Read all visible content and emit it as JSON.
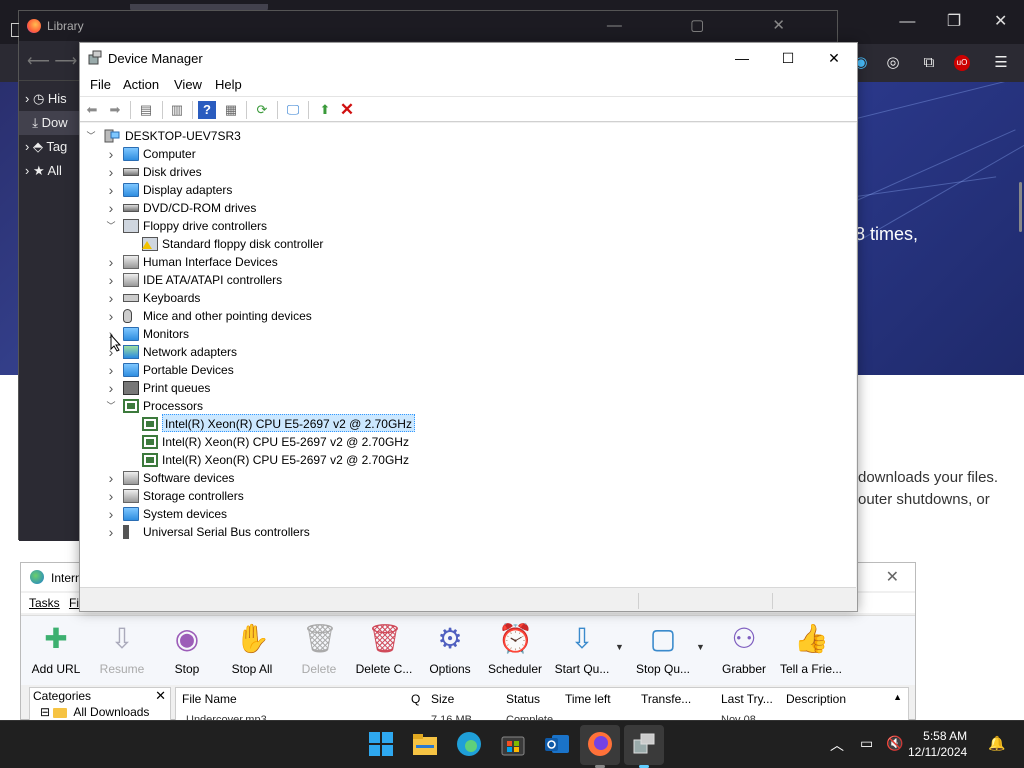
{
  "browser": {
    "hero_text": "o 8 times,",
    "body_text_1": "downloads your files.",
    "body_text_2": "outer shutdowns, or"
  },
  "library": {
    "title": "Library",
    "sidebar": [
      {
        "label": "His",
        "icon": "clock-icon"
      },
      {
        "label": "Dow",
        "icon": "download-icon"
      },
      {
        "label": "Tag",
        "icon": "tag-icon"
      },
      {
        "label": "All",
        "icon": "star-icon"
      }
    ]
  },
  "device_manager": {
    "title": "Device Manager",
    "menu": [
      "File",
      "Action",
      "View",
      "Help"
    ],
    "root": "DESKTOP-UEV7SR3",
    "tree": [
      {
        "label": "Computer",
        "state": "collapsed",
        "icon": "monitor"
      },
      {
        "label": "Disk drives",
        "state": "collapsed",
        "icon": "disk"
      },
      {
        "label": "Display adapters",
        "state": "collapsed",
        "icon": "monitor"
      },
      {
        "label": "DVD/CD-ROM drives",
        "state": "collapsed",
        "icon": "disk"
      },
      {
        "label": "Floppy drive controllers",
        "state": "expanded",
        "icon": "floppy"
      },
      {
        "label": "Standard floppy disk controller",
        "state": "child",
        "icon": "floppy-warn"
      },
      {
        "label": "Human Interface Devices",
        "state": "collapsed",
        "icon": "gray"
      },
      {
        "label": "IDE ATA/ATAPI controllers",
        "state": "collapsed",
        "icon": "gray"
      },
      {
        "label": "Keyboards",
        "state": "collapsed",
        "icon": "kbd"
      },
      {
        "label": "Mice and other pointing devices",
        "state": "collapsed",
        "icon": "mouse"
      },
      {
        "label": "Monitors",
        "state": "collapsed",
        "icon": "monitor"
      },
      {
        "label": "Network adapters",
        "state": "collapsed",
        "icon": "net"
      },
      {
        "label": "Portable Devices",
        "state": "collapsed",
        "icon": "monitor"
      },
      {
        "label": "Print queues",
        "state": "collapsed",
        "icon": "print"
      },
      {
        "label": "Processors",
        "state": "expanded",
        "icon": "chip"
      },
      {
        "label": "Intel(R) Xeon(R) CPU E5-2697 v2 @ 2.70GHz",
        "state": "child-selected",
        "icon": "chip"
      },
      {
        "label": "Intel(R) Xeon(R) CPU E5-2697 v2 @ 2.70GHz",
        "state": "child",
        "icon": "chip"
      },
      {
        "label": "Intel(R) Xeon(R) CPU E5-2697 v2 @ 2.70GHz",
        "state": "child",
        "icon": "chip"
      },
      {
        "label": "Software devices",
        "state": "collapsed",
        "icon": "gray"
      },
      {
        "label": "Storage controllers",
        "state": "collapsed",
        "icon": "gray"
      },
      {
        "label": "System devices",
        "state": "collapsed",
        "icon": "monitor"
      },
      {
        "label": "Universal Serial Bus controllers",
        "state": "collapsed",
        "icon": "usb"
      }
    ]
  },
  "idm": {
    "title": "Intern",
    "menu": [
      "Tasks",
      "Fi"
    ],
    "buttons": [
      {
        "label": "Add URL",
        "icon": "add-url-icon",
        "glyph": "✚",
        "enabled": true,
        "color": "#3db070"
      },
      {
        "label": "Resume",
        "icon": "resume-icon",
        "glyph": "⇩",
        "enabled": false,
        "color": "#aab"
      },
      {
        "label": "Stop",
        "icon": "stop-icon",
        "glyph": "◉",
        "enabled": true,
        "color": "#9c5cb8"
      },
      {
        "label": "Stop All",
        "icon": "stop-all-icon",
        "glyph": "✋",
        "enabled": true,
        "color": "#d04a5a"
      },
      {
        "label": "Delete",
        "icon": "delete-icon",
        "glyph": "🗑",
        "enabled": false,
        "color": "#aaa"
      },
      {
        "label": "Delete C...",
        "icon": "delete-completed-icon",
        "glyph": "🗑",
        "enabled": true,
        "color": "#d04a5a"
      },
      {
        "label": "Options",
        "icon": "options-icon",
        "glyph": "⚙",
        "enabled": true,
        "color": "#5060c0"
      },
      {
        "label": "Scheduler",
        "icon": "scheduler-icon",
        "glyph": "⏰",
        "enabled": true,
        "color": "#d07050"
      },
      {
        "label": "Start Qu...",
        "icon": "start-queue-icon",
        "glyph": "⇩",
        "enabled": true,
        "color": "#3a8acc"
      },
      {
        "label": "Stop Qu...",
        "icon": "stop-queue-icon",
        "glyph": "▢",
        "enabled": true,
        "color": "#3a8acc"
      },
      {
        "label": "Grabber",
        "icon": "grabber-icon",
        "glyph": "⚇",
        "enabled": true,
        "color": "#8060c0"
      },
      {
        "label": "Tell a Frie...",
        "icon": "tell-friend-icon",
        "glyph": "👍",
        "enabled": true,
        "color": "#4a80c0"
      }
    ],
    "categories_header": "Categories",
    "category_item": "All Downloads",
    "columns": [
      "File Name",
      "Q",
      "Size",
      "Status",
      "Time left",
      "Transfe...",
      "Last Try...",
      "Description"
    ],
    "row": {
      "file": "Undercover.mp3",
      "size": "7.16  MB",
      "status": "Complete",
      "last_try": "Nov 08"
    }
  },
  "taskbar": {
    "time": "5:58 AM",
    "date": "12/11/2024"
  }
}
